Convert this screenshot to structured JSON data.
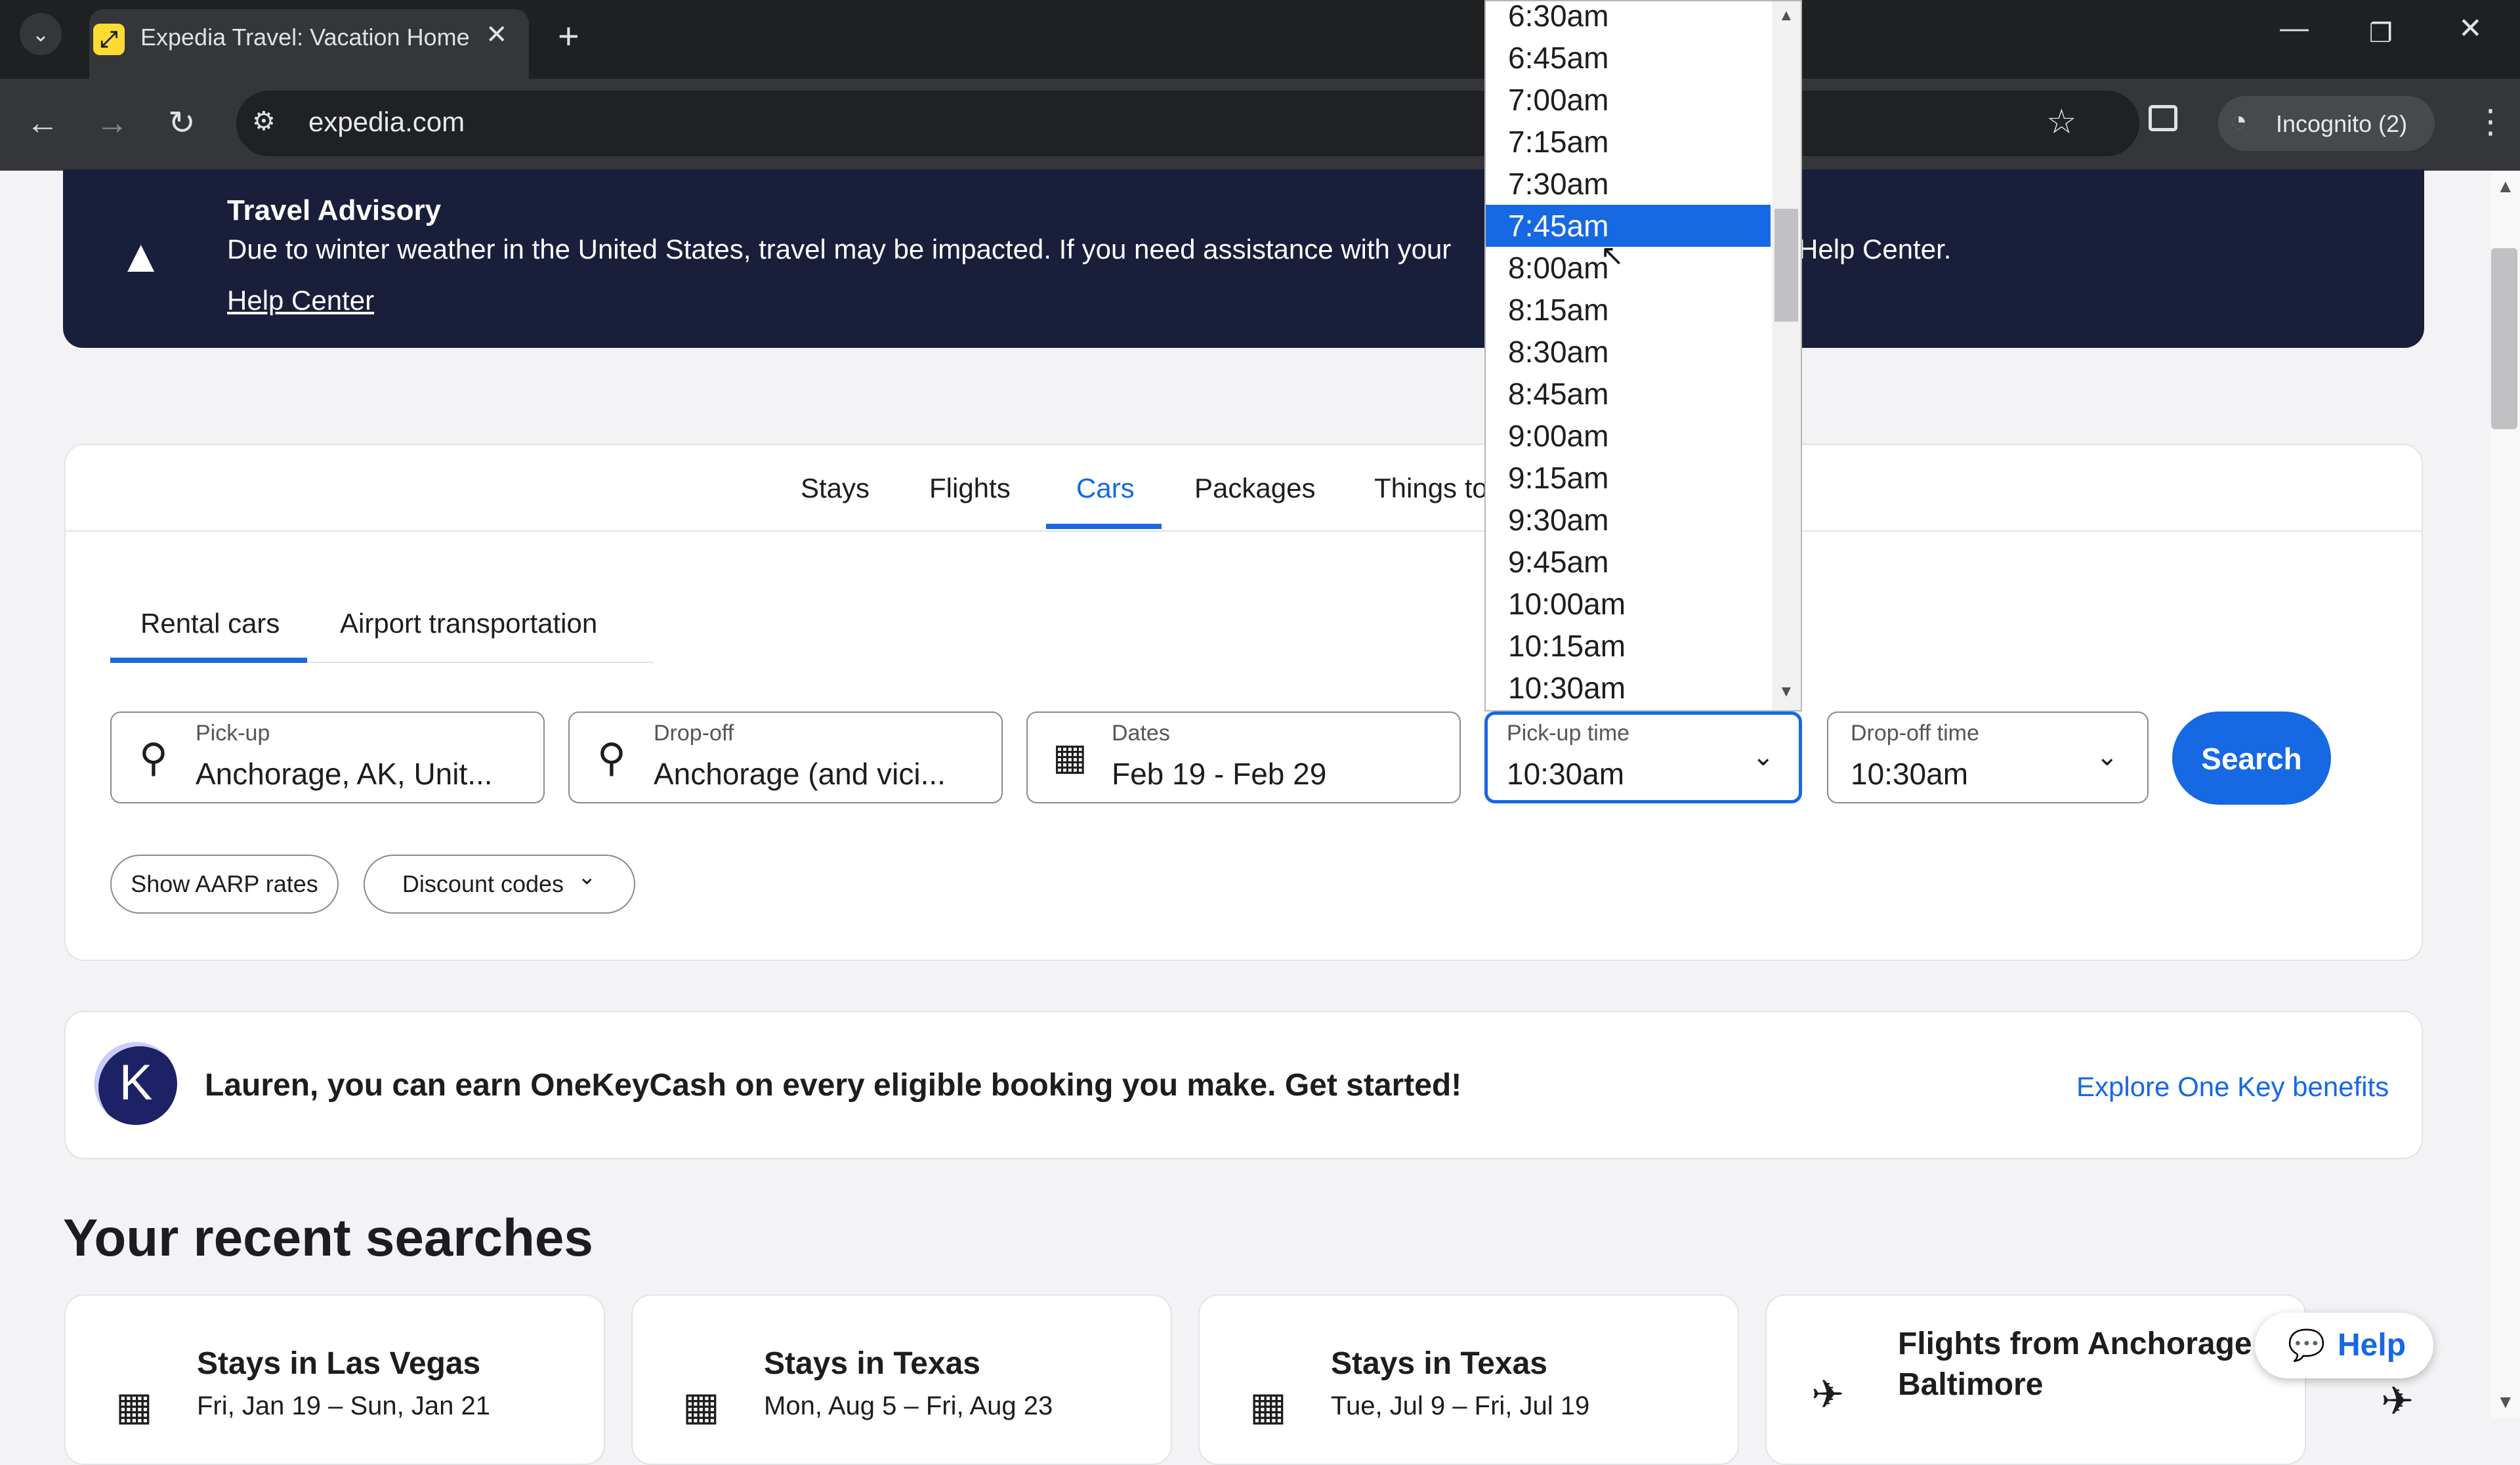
{
  "browser": {
    "tab_title": "Expedia Travel: Vacation Homes",
    "url": "expedia.com",
    "profile_label": "Incognito (2)"
  },
  "advisory": {
    "title": "Travel Advisory",
    "text": "Due to winter weather in the United States, travel may be impacted. If you need assistance with your",
    "text_tail": "Help Center.",
    "link": "Help Center"
  },
  "product_tabs": [
    "Stays",
    "Flights",
    "Cars",
    "Packages",
    "Things to"
  ],
  "active_product_tab": "Cars",
  "sub_tabs": [
    "Rental cars",
    "Airport transportation"
  ],
  "form": {
    "pickup": {
      "label": "Pick-up",
      "value": "Anchorage, AK, Unit..."
    },
    "dropoff": {
      "label": "Drop-off",
      "value": "Anchorage (and vici..."
    },
    "dates": {
      "label": "Dates",
      "value": "Feb 19 - Feb 29"
    },
    "pickup_time": {
      "label": "Pick-up time",
      "value": "10:30am"
    },
    "dropoff_time": {
      "label": "Drop-off time",
      "value": "10:30am"
    },
    "search_label": "Search",
    "aarp_label": "Show AARP rates",
    "discount_label": "Discount codes"
  },
  "time_options": [
    "6:30am",
    "6:45am",
    "7:00am",
    "7:15am",
    "7:30am",
    "7:45am",
    "8:00am",
    "8:15am",
    "8:30am",
    "8:45am",
    "9:00am",
    "9:15am",
    "9:30am",
    "9:45am",
    "10:00am",
    "10:15am",
    "10:30am"
  ],
  "highlighted_option": "7:45am",
  "onekey": {
    "logo_letter": "K",
    "text": "Lauren, you can earn OneKeyCash on every eligible booking you make. Get started!",
    "link": "Explore One Key benefits"
  },
  "recent": {
    "heading": "Your recent searches",
    "cards": [
      {
        "title": "Stays in Las Vegas",
        "sub": "Fri, Jan 19 – Sun, Jan 21",
        "icon": "building-icon"
      },
      {
        "title": "Stays in Texas",
        "sub": "Mon, Aug 5 – Fri, Aug 23",
        "icon": "building-icon"
      },
      {
        "title": "Stays in Texas",
        "sub": "Tue, Jul 9 – Fri, Jul 19",
        "icon": "building-icon"
      },
      {
        "title": "Flights from Anchorage t",
        "sub": "Baltimore",
        "icon": "plane-icon"
      }
    ]
  },
  "help_label": "Help",
  "colors": {
    "accent": "#1668e3",
    "advisory_bg": "#191e3b"
  }
}
